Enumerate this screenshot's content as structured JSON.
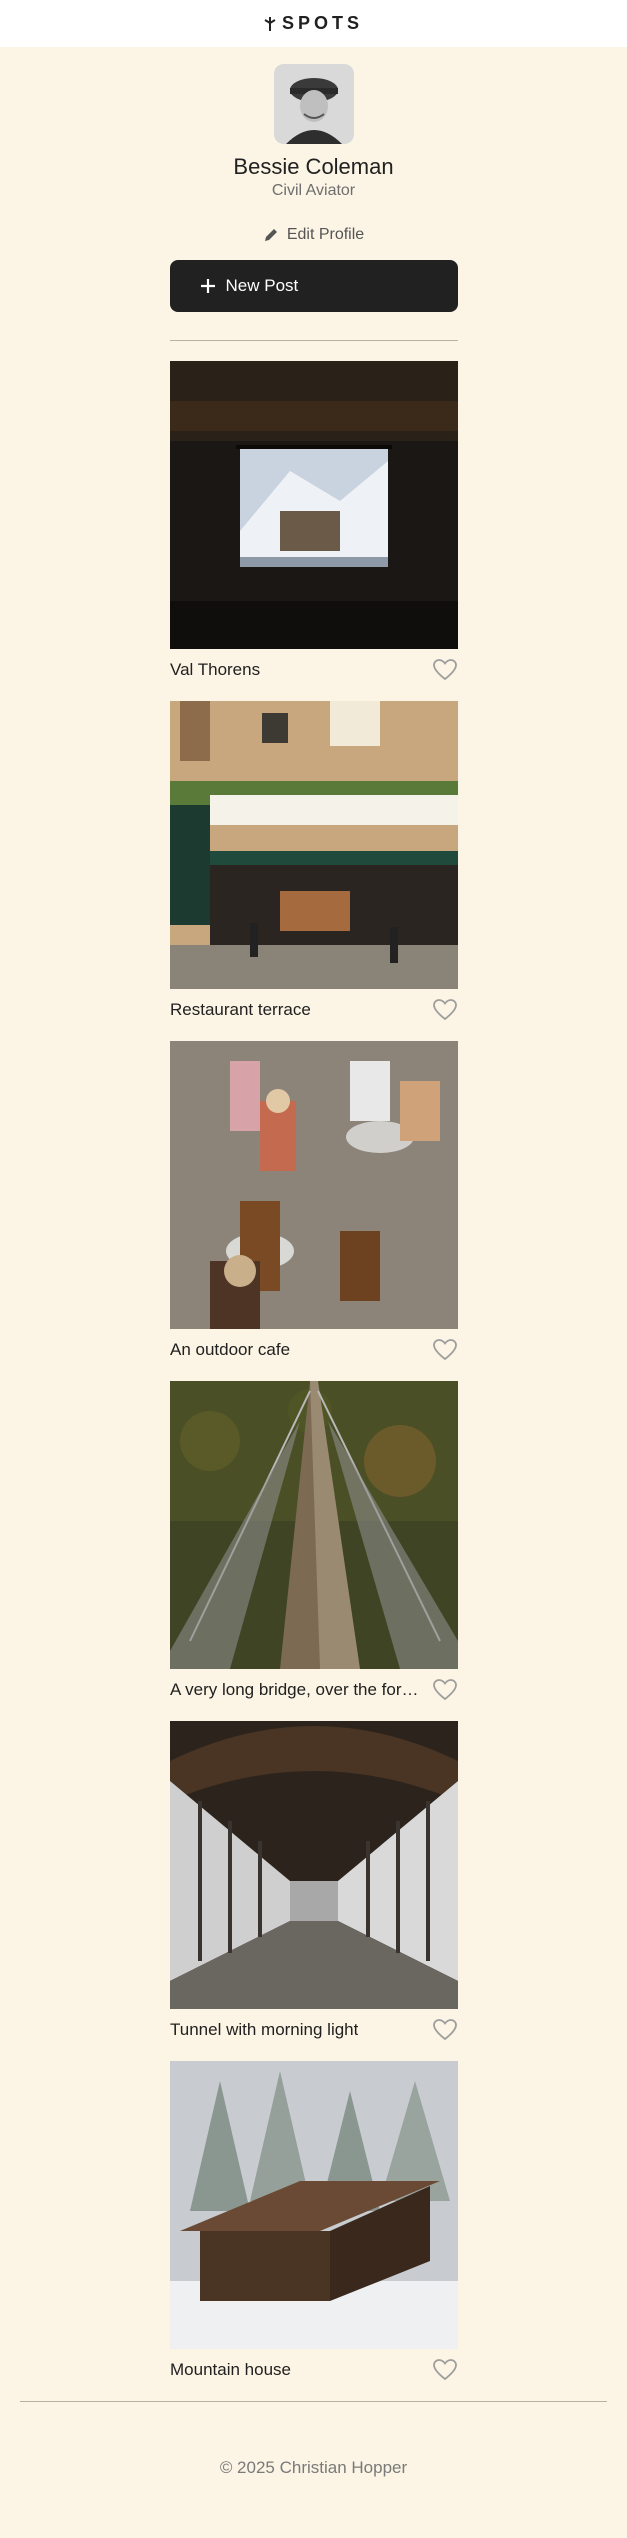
{
  "header": {
    "brand": "SPOTS"
  },
  "profile": {
    "name": "Bessie Coleman",
    "role": "Civil Aviator",
    "edit_label": "Edit Profile",
    "new_post_label": "New Post"
  },
  "cards": [
    {
      "title": "Val Thorens"
    },
    {
      "title": "Restaurant terrace"
    },
    {
      "title": "An outdoor cafe"
    },
    {
      "title": "A very long bridge, over the forest and through the trees"
    },
    {
      "title": "Tunnel with morning light"
    },
    {
      "title": "Mountain house"
    }
  ],
  "footer": {
    "copyright": "© 2025 Christian Hopper"
  },
  "colors": {
    "background": "#fcf5e5",
    "dark": "#212121",
    "muted": "#6e6e6e"
  }
}
